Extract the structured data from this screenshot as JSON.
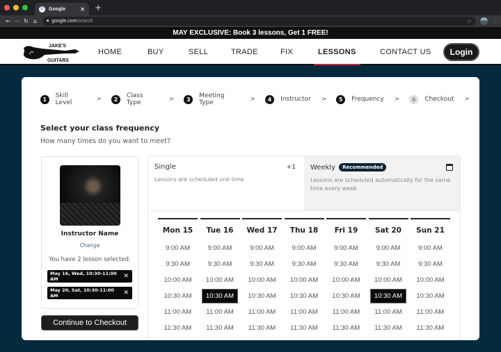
{
  "browser": {
    "tab_title": "Google",
    "url_host": "google.com",
    "url_path": "/search"
  },
  "promo_banner": "MAY EXCLUSIVE: Book 3 lessons, Get 1 FREE!",
  "site": {
    "logo_top": "JAKE'S",
    "logo_bottom": "GUITARS",
    "nav": [
      {
        "label": "HOME"
      },
      {
        "label": "BUY"
      },
      {
        "label": "SELL"
      },
      {
        "label": "TRADE"
      },
      {
        "label": "FIX"
      },
      {
        "label": "LESSONS"
      },
      {
        "label": "CONTACT US"
      }
    ],
    "active_nav": "LESSONS",
    "login_label": "Login",
    "accent_color": "#d0223a"
  },
  "steps": [
    {
      "num": "1",
      "label": "Skill Level",
      "state": "done"
    },
    {
      "num": "2",
      "label": "Class Type",
      "state": "done"
    },
    {
      "num": "3",
      "label": "Meeting Type",
      "state": "done"
    },
    {
      "num": "4",
      "label": "Instructor",
      "state": "done"
    },
    {
      "num": "5",
      "label": "Frequency",
      "state": "current"
    },
    {
      "num": "6",
      "label": "Checkout",
      "state": "pending"
    }
  ],
  "heading": "Select your class frequency",
  "subheading": "How many times do you want to meet?",
  "instructor": {
    "name": "Instructor Name",
    "change_label": "Change",
    "selection_text": "You have 2 lesson selected.",
    "selected": [
      "May 16, Wed, 10:30-11:00 AM",
      "May 20, Sat, 10:30-11:00 AM"
    ]
  },
  "checkout_label": "Continue to Checkout",
  "frequency": {
    "single": {
      "title": "Single",
      "desc": "Lessons are scheduled one time",
      "tag": "+1"
    },
    "weekly": {
      "title": "Weekly",
      "badge": "Recommended",
      "desc": "Lessons are scheduled automatically for the same time every week",
      "selected": true
    }
  },
  "schedule": {
    "days": [
      "Mon 15",
      "Tue 16",
      "Wed 17",
      "Thu 18",
      "Fri 19",
      "Sat 20",
      "Sun 21"
    ],
    "times": [
      "9:00 AM",
      "9:30 AM",
      "10:00 AM",
      "10:30 AM",
      "11:00 AM",
      "11:30 AM"
    ],
    "selected": [
      {
        "day": "Tue 16",
        "time": "10:30 AM"
      },
      {
        "day": "Sat 20",
        "time": "10:30 AM"
      }
    ]
  }
}
